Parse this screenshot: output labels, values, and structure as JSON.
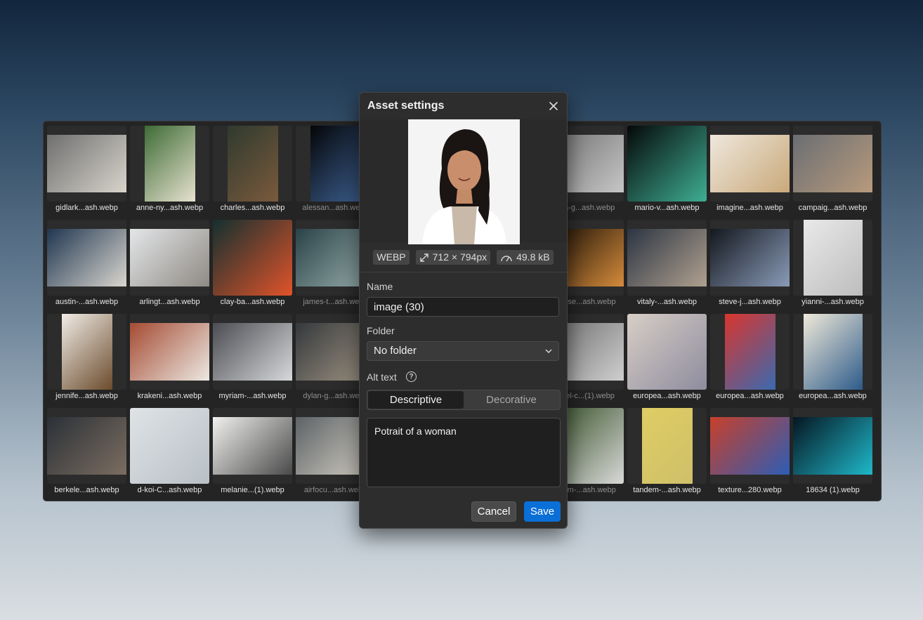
{
  "library": {
    "assets": [
      {
        "name": "gidlark...ash.webp",
        "shape": "land",
        "c1": "#6f6f6f",
        "c2": "#d8d4cc",
        "dim": false
      },
      {
        "name": "anne-ny...ash.webp",
        "shape": "port",
        "c1": "#3e6b36",
        "c2": "#e7e2cf",
        "dim": false
      },
      {
        "name": "charles...ash.webp",
        "shape": "port",
        "c1": "#2f3a2f",
        "c2": "#7a5a3c",
        "dim": false
      },
      {
        "name": "alessan...ash.webp",
        "shape": "port",
        "c1": "#050608",
        "c2": "#3b5d8c",
        "dim": true
      },
      {
        "name": "",
        "shape": "full",
        "c1": "#333",
        "c2": "#555",
        "dim": true
      },
      {
        "name": "",
        "shape": "full",
        "c1": "#333",
        "c2": "#555",
        "dim": true
      },
      {
        "name": "...na-g...ash.webp",
        "shape": "land",
        "c1": "#6f6f6f",
        "c2": "#c6c6c6",
        "dim": true
      },
      {
        "name": "mario-v...ash.webp",
        "shape": "full",
        "c1": "#050808",
        "c2": "#3fae93",
        "dim": false
      },
      {
        "name": "imagine...ash.webp",
        "shape": "land",
        "c1": "#efe7dd",
        "c2": "#c9a97a",
        "dim": false
      },
      {
        "name": "campaig...ash.webp",
        "shape": "land",
        "c1": "#6b6e73",
        "c2": "#b79a7c",
        "dim": false
      },
      {
        "name": "austin-...ash.webp",
        "shape": "land",
        "c1": "#1f3650",
        "c2": "#dad6cf",
        "dim": false
      },
      {
        "name": "arlingt...ash.webp",
        "shape": "land",
        "c1": "#e3e6e8",
        "c2": "#8f8a84",
        "dim": false
      },
      {
        "name": "clay-ba...ash.webp",
        "shape": "full",
        "c1": "#13302f",
        "c2": "#e0532a",
        "dim": false
      },
      {
        "name": "james-t...ash.webp",
        "shape": "land",
        "c1": "#2a4247",
        "c2": "#9cb2b1",
        "dim": true
      },
      {
        "name": "",
        "shape": "full",
        "c1": "#333",
        "c2": "#555",
        "dim": true
      },
      {
        "name": "",
        "shape": "full",
        "c1": "#333",
        "c2": "#555",
        "dim": true
      },
      {
        "name": "...rc-se...ash.webp",
        "shape": "land",
        "c1": "#100a05",
        "c2": "#d58b3b",
        "dim": true
      },
      {
        "name": "vitaly-...ash.webp",
        "shape": "land",
        "c1": "#2c3542",
        "c2": "#b0a190",
        "dim": false
      },
      {
        "name": "steve-j...ash.webp",
        "shape": "land",
        "c1": "#14181e",
        "c2": "#8a9bb8",
        "dim": false
      },
      {
        "name": "yianni-...ash.webp",
        "shape": "tall",
        "c1": "#e9e9e9",
        "c2": "#bdbdbd",
        "dim": false
      },
      {
        "name": "jennife...ash.webp",
        "shape": "port",
        "c1": "#f0ece6",
        "c2": "#6b4b2c",
        "dim": false
      },
      {
        "name": "krakeni...ash.webp",
        "shape": "land",
        "c1": "#a54b33",
        "c2": "#ece8e2",
        "dim": false
      },
      {
        "name": "myriam-...ash.webp",
        "shape": "land",
        "c1": "#4c4d52",
        "c2": "#d7d8db",
        "dim": false
      },
      {
        "name": "dylan-g...ash.webp",
        "shape": "land",
        "c1": "#34383c",
        "c2": "#a49886",
        "dim": true
      },
      {
        "name": "",
        "shape": "full",
        "c1": "#333",
        "c2": "#555",
        "dim": true
      },
      {
        "name": "",
        "shape": "full",
        "c1": "#333",
        "c2": "#555",
        "dim": true
      },
      {
        "name": "...wel-c...(1).webp",
        "shape": "land",
        "c1": "#6a6a6a",
        "c2": "#cfcfcf",
        "dim": true
      },
      {
        "name": "europea...ash.webp",
        "shape": "full",
        "c1": "#d7cec6",
        "c2": "#8e8c9e",
        "dim": false
      },
      {
        "name": "europea...ash.webp",
        "shape": "port",
        "c1": "#d9352d",
        "c2": "#3a6ab0",
        "dim": false
      },
      {
        "name": "europea...ash.webp",
        "shape": "tall",
        "c1": "#efe9d9",
        "c2": "#2e5b8a",
        "dim": false
      },
      {
        "name": "berkele...ash.webp",
        "shape": "land",
        "c1": "#2b3138",
        "c2": "#7b6d60",
        "dim": false
      },
      {
        "name": "d-koi-C...ash.webp",
        "shape": "full",
        "c1": "#dfe3e6",
        "c2": "#b8c0c6",
        "dim": false
      },
      {
        "name": "melanie...(1).webp",
        "shape": "land",
        "c1": "#f0f0ee",
        "c2": "#4a4a4a",
        "dim": false
      },
      {
        "name": "airfocu...ash.webp",
        "shape": "land",
        "c1": "#5c6266",
        "c2": "#d6d1c6",
        "dim": true
      },
      {
        "name": "",
        "shape": "full",
        "c1": "#333",
        "c2": "#555",
        "dim": true
      },
      {
        "name": "",
        "shape": "full",
        "c1": "#333",
        "c2": "#555",
        "dim": true
      },
      {
        "name": "...dem-...ash.webp",
        "shape": "full",
        "c1": "#2f4a20",
        "c2": "#d9d9d9",
        "dim": true
      },
      {
        "name": "tandem-...ash.webp",
        "shape": "port",
        "c1": "#dfcd63",
        "c2": "#cfc06a",
        "dim": false
      },
      {
        "name": "texture...280.webp",
        "shape": "land",
        "c1": "#c8402a",
        "c2": "#2d5db5",
        "dim": false
      },
      {
        "name": "18634 (1).webp",
        "shape": "land",
        "c1": "#061622",
        "c2": "#1fb8c9",
        "dim": false
      }
    ]
  },
  "dialog": {
    "title": "Asset settings",
    "meta": {
      "format": "WEBP",
      "dimensions": "712 × 794px",
      "size": "49.8 kB"
    },
    "name_label": "Name",
    "name_value": "image (30)",
    "folder_label": "Folder",
    "folder_value": "No folder",
    "alt_label": "Alt text",
    "alt_tabs": [
      "Descriptive",
      "Decorative"
    ],
    "alt_value": "Potrait of a woman",
    "cancel_label": "Cancel",
    "save_label": "Save"
  },
  "colors": {
    "accent": "#0a6fd6"
  }
}
